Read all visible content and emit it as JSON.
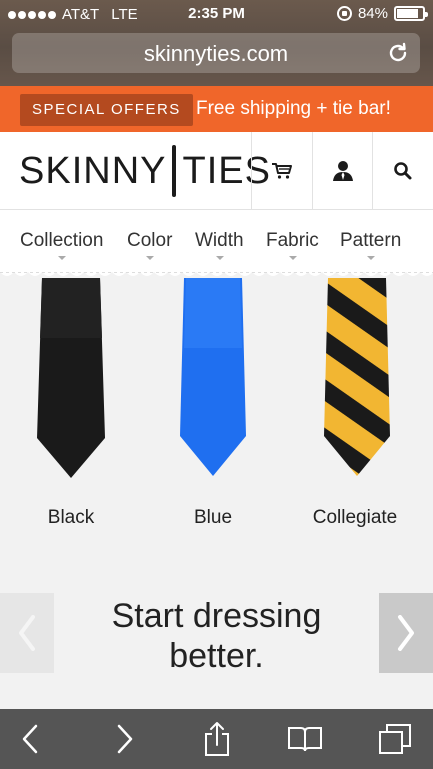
{
  "status_bar": {
    "carrier": "AT&T",
    "network": "LTE",
    "time": "2:35 PM",
    "battery": "84%",
    "battery_level": 0.84
  },
  "browser": {
    "url": "skinnyties.com"
  },
  "offers": {
    "badge": "SPECIAL OFFERS",
    "promo": "Free shipping + tie bar!"
  },
  "header": {
    "logo_left": "SKINNY",
    "logo_right": "TIES",
    "icons": [
      "cart-icon",
      "account-icon",
      "search-icon"
    ]
  },
  "nav": {
    "items": [
      "Collection",
      "Color",
      "Width",
      "Fabric",
      "Pattern"
    ]
  },
  "products": [
    {
      "label": "Black",
      "color": "#1a1a1a"
    },
    {
      "label": "Blue",
      "color": "#1f6ff0"
    },
    {
      "label": "Collegiate",
      "color": "#f2b632"
    }
  ],
  "carousel": {
    "headline": "Start dressing better."
  },
  "colors": {
    "accent": "#f0662a",
    "badge": "#b44a1f",
    "toolbar": "#555555"
  }
}
